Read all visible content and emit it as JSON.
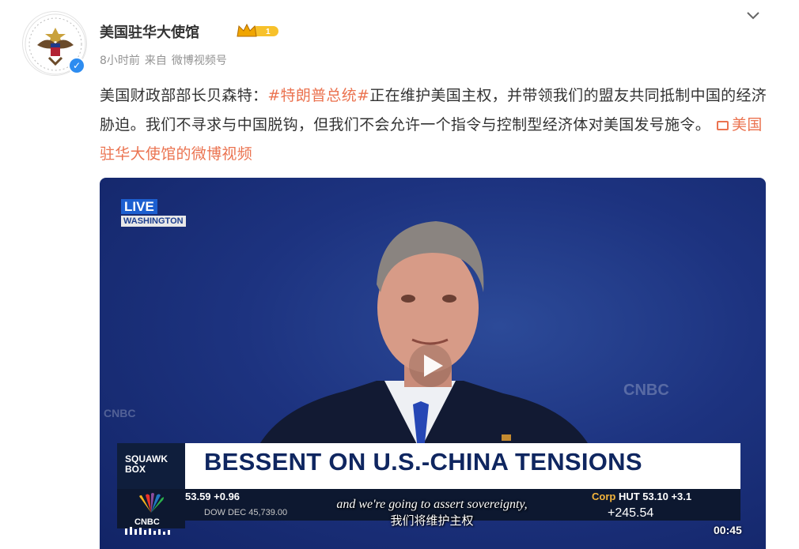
{
  "account": {
    "name": "美国驻华大使馆",
    "time": "8小时前",
    "source_prefix": "来自",
    "source": "微博视频号"
  },
  "post": {
    "text_1": "美国财政部部长贝森特：",
    "hashtag": "#特朗普总统#",
    "text_2": "正在维护美国主权，并带领我们的盟友共同抵制中国的经济胁迫。我们不寻求与中国脱钩，但我们不会允许一个指令与控制型经济体对美国发号施令。",
    "video_link": "美国驻华大使馆的微博视频"
  },
  "video": {
    "live": "LIVE",
    "location": "WASHINGTON",
    "show_line1": "SQUAWK",
    "show_line2": "BOX",
    "headline": "BESSENT ON U.S.-CHINA TENSIONS",
    "ticker_left": "53.59 +0.96",
    "ticker_corp": "Corp",
    "ticker_right": "HUT 53.10 +3.1",
    "ticker_bottom_left": "DOW   DEC   45,739.00",
    "ticker_bottom_right": "+245.54",
    "subtitle_en": "and we're going to assert sovereignty,",
    "subtitle_zh": "我们将维护主权",
    "time": "00:45",
    "bg_logo": "CNBC"
  },
  "colors": {
    "accent": "#eb7350",
    "verified": "#2d8cf0",
    "headline": "#0f2660"
  }
}
